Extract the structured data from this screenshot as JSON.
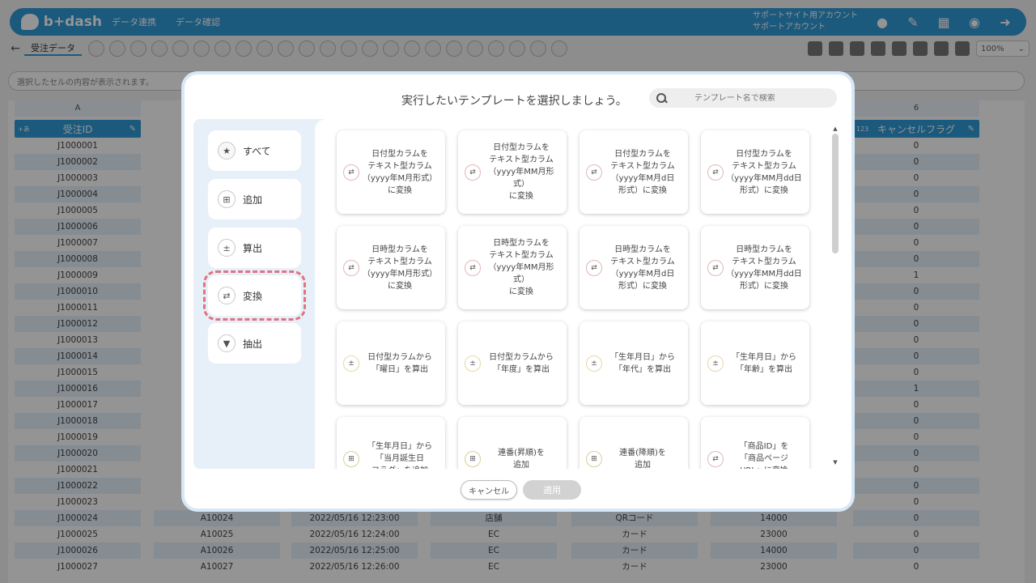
{
  "app": {
    "logo_text": "b+dash",
    "nav": [
      "データ連携",
      "データ確認"
    ],
    "account_line1": "サポートサイト用アカウント",
    "account_line2": "サポートアカウント",
    "tab_name": "受注データ",
    "zoom": "100%",
    "cell_info_placeholder": "選択したセルの内容が表示されます。"
  },
  "grid": {
    "col_a_letter": "A",
    "col_a_header": "受注ID",
    "col_g_letter": "6",
    "col_g_header": "キャンセルフラグ",
    "order_ids": [
      "J1000001",
      "J1000002",
      "J1000003",
      "J1000004",
      "J1000005",
      "J1000006",
      "J1000007",
      "J1000008",
      "J1000009",
      "J1000010",
      "J1000011",
      "J1000012",
      "J1000013",
      "J1000014",
      "J1000015",
      "J1000016",
      "J1000017",
      "J1000018",
      "J1000019",
      "J1000020",
      "J1000021",
      "J1000022",
      "J1000023",
      "J1000024",
      "J1000025",
      "J1000026",
      "J1000027"
    ],
    "cancel_flags": [
      "0",
      "0",
      "0",
      "0",
      "0",
      "0",
      "0",
      "0",
      "1",
      "0",
      "0",
      "0",
      "0",
      "0",
      "0",
      "1",
      "0",
      "0",
      "0",
      "0",
      "0",
      "0",
      "0",
      "0",
      "0",
      "0",
      "0"
    ],
    "bottom_rows": [
      {
        "b": "A10024",
        "c": "2022/05/16 12:23:00",
        "d": "店舗",
        "e": "QRコード",
        "f": "14000"
      },
      {
        "b": "A10025",
        "c": "2022/05/16 12:24:00",
        "d": "EC",
        "e": "カード",
        "f": "23000"
      },
      {
        "b": "A10026",
        "c": "2022/05/16 12:25:00",
        "d": "EC",
        "e": "カード",
        "f": "14000"
      },
      {
        "b": "A10027",
        "c": "2022/05/16 12:26:00",
        "d": "EC",
        "e": "カード",
        "f": "23000"
      }
    ]
  },
  "modal": {
    "title": "実行したいテンプレートを選択しましょう。",
    "search_placeholder": "テンプレート名で検索",
    "categories": [
      {
        "label": "すべて",
        "icon": "star-icon"
      },
      {
        "label": "追加",
        "icon": "plus-box-icon"
      },
      {
        "label": "算出",
        "icon": "calculator-icon"
      },
      {
        "label": "変換",
        "icon": "convert-icon"
      },
      {
        "label": "抽出",
        "icon": "filter-icon"
      }
    ],
    "cards": [
      {
        "text": "日付型カラムを\nテキスト型カラム\n（yyyy年M月形式）\nに変換",
        "icon": "convert-icon"
      },
      {
        "text": "日付型カラムを\nテキスト型カラム\n（yyyy年MM月形\n式）\nに変換",
        "icon": "convert-icon"
      },
      {
        "text": "日付型カラムを\nテキスト型カラム\n（yyyy年M月d日\n形式）に変換",
        "icon": "convert-icon"
      },
      {
        "text": "日付型カラムを\nテキスト型カラム\n（yyyy年MM月dd日\n形式）に変換",
        "icon": "convert-icon"
      },
      {
        "text": "日時型カラムを\nテキスト型カラム\n（yyyy年M月形式）\nに変換",
        "icon": "convert-icon"
      },
      {
        "text": "日時型カラムを\nテキスト型カラム\n（yyyy年MM月形\n式）\nに変換",
        "icon": "convert-icon"
      },
      {
        "text": "日時型カラムを\nテキスト型カラム\n（yyyy年M月d日\n形式）に変換",
        "icon": "convert-icon"
      },
      {
        "text": "日時型カラムを\nテキスト型カラム\n（yyyy年MM月dd日\n形式）に変換",
        "icon": "convert-icon"
      },
      {
        "text": "日付型カラムから\n「曜日」を算出",
        "icon": "calculator-icon"
      },
      {
        "text": "日付型カラムから\n「年度」を算出",
        "icon": "calculator-icon"
      },
      {
        "text": "「生年月日」から\n「年代」を算出",
        "icon": "calculator-icon"
      },
      {
        "text": "「生年月日」から\n「年齢」を算出",
        "icon": "calculator-icon"
      },
      {
        "text": "「生年月日」から\n「当月誕生日\nフラグ」を追加",
        "icon": "plus-box-icon"
      },
      {
        "text": "連番(昇順)を\n追加",
        "icon": "plus-box-icon"
      },
      {
        "text": "連番(降順)を\n追加",
        "icon": "plus-box-icon"
      },
      {
        "text": "「商品ID」を\n「商品ページ\nURL」に変換",
        "icon": "convert-icon"
      }
    ],
    "cancel_label": "キャンセル",
    "apply_label": "適用"
  }
}
